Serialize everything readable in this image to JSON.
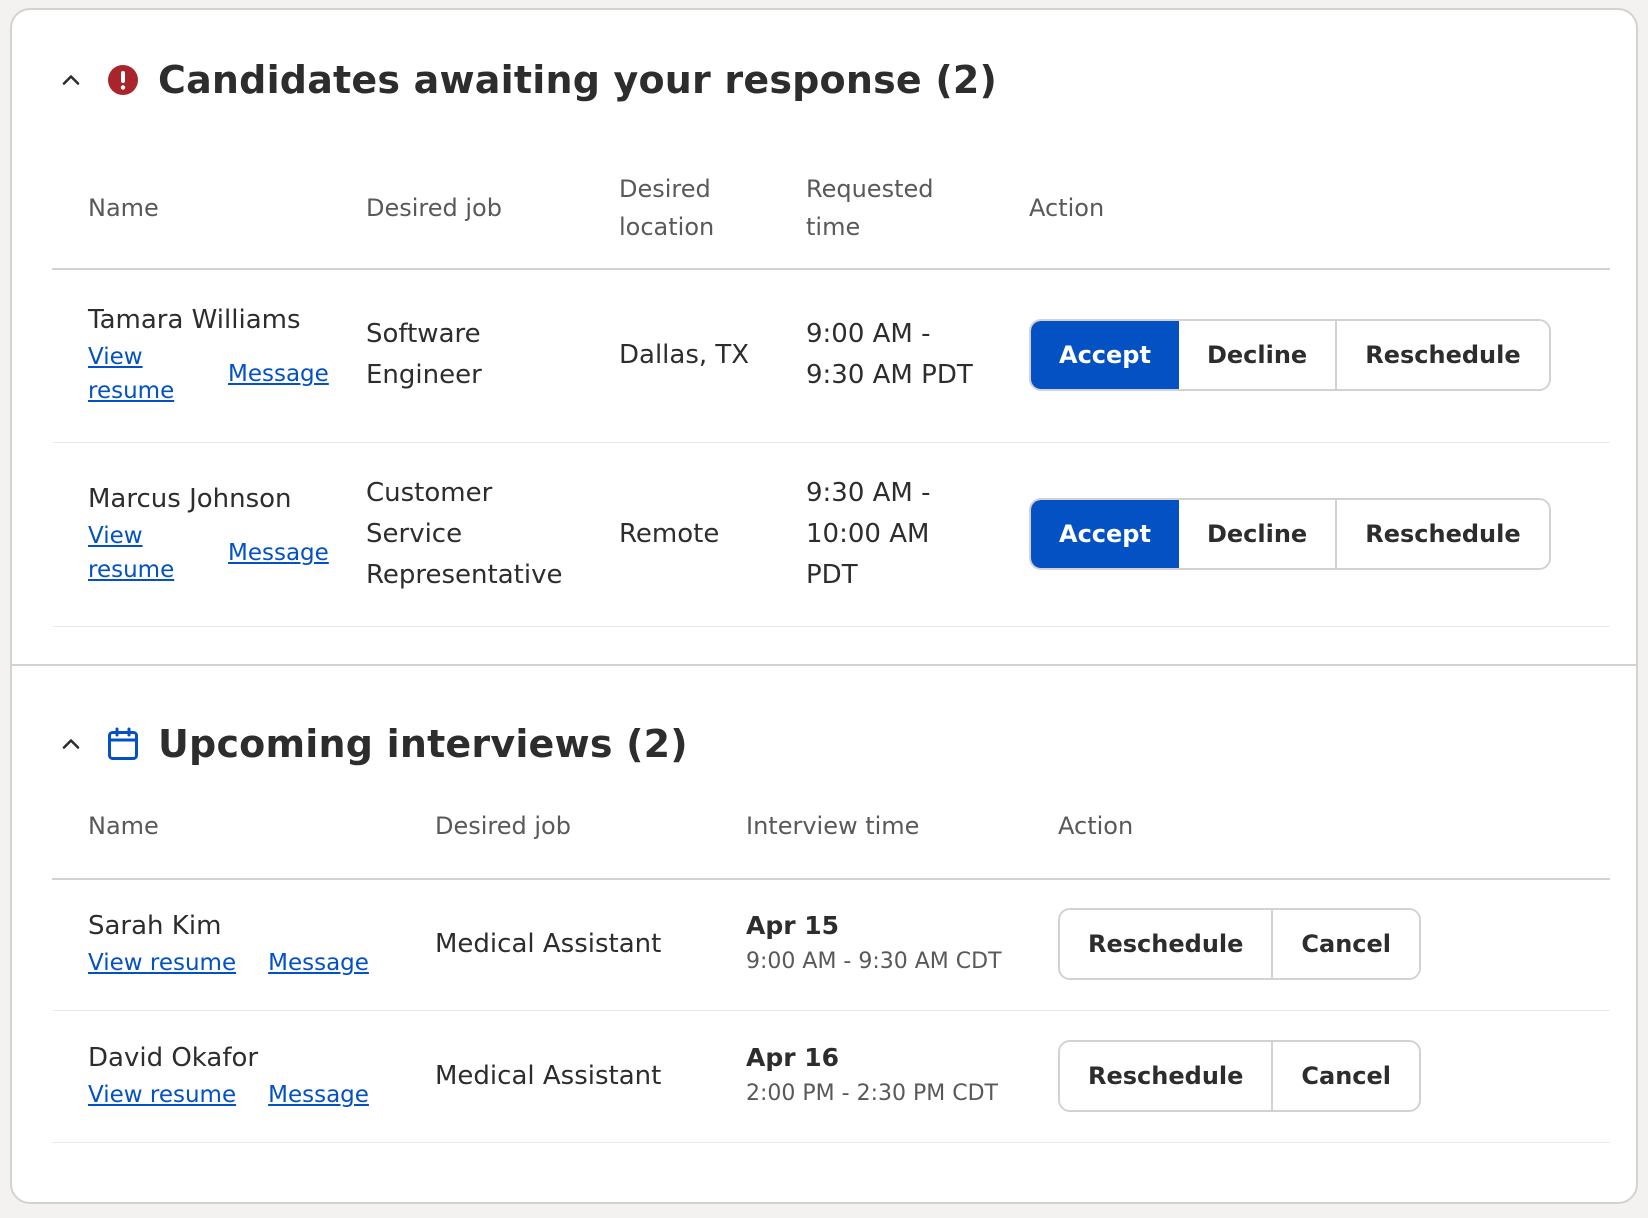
{
  "pending": {
    "title": "Candidates awaiting your response (2)",
    "columns": {
      "name": "Name",
      "job": "Desired job",
      "location": "Desired location",
      "time": "Requested time",
      "action": "Action"
    },
    "rows": [
      {
        "name": "Tamara Williams",
        "view_resume": "View resume",
        "message": "Message",
        "job": "Software Engineer",
        "location": "Dallas, TX",
        "time": "9:00 AM - 9:30 AM PDT",
        "accept": "Accept",
        "decline": "Decline",
        "reschedule": "Reschedule"
      },
      {
        "name": "Marcus Johnson",
        "view_resume": "View resume",
        "message": "Message",
        "job": "Customer Service Representative",
        "location": "Remote",
        "time": "9:30 AM - 10:00 AM PDT",
        "accept": "Accept",
        "decline": "Decline",
        "reschedule": "Reschedule"
      }
    ]
  },
  "upcoming": {
    "title": "Upcoming interviews (2)",
    "columns": {
      "name": "Name",
      "job": "Desired job",
      "time": "Interview time",
      "action": "Action"
    },
    "rows": [
      {
        "name": "Sarah Kim",
        "view_resume": "View resume",
        "message": "Message",
        "job": "Medical Assistant",
        "date": "Apr 15",
        "time": "9:00 AM - 9:30 AM CDT",
        "reschedule": "Reschedule",
        "cancel": "Cancel"
      },
      {
        "name": "David Okafor",
        "view_resume": "View resume",
        "message": "Message",
        "job": "Medical Assistant",
        "date": "Apr 16",
        "time": "2:00 PM - 2:30 PM CDT",
        "reschedule": "Reschedule",
        "cancel": "Cancel"
      }
    ]
  },
  "colors": {
    "primary": "#0451c4",
    "alert": "#a9252b",
    "text": "#2d2d2d",
    "muted": "#595959",
    "border": "#d4d2d0"
  },
  "icons": {
    "collapse": "chevron-up-icon",
    "alert": "exclamation-circle-icon",
    "calendar": "calendar-icon"
  }
}
